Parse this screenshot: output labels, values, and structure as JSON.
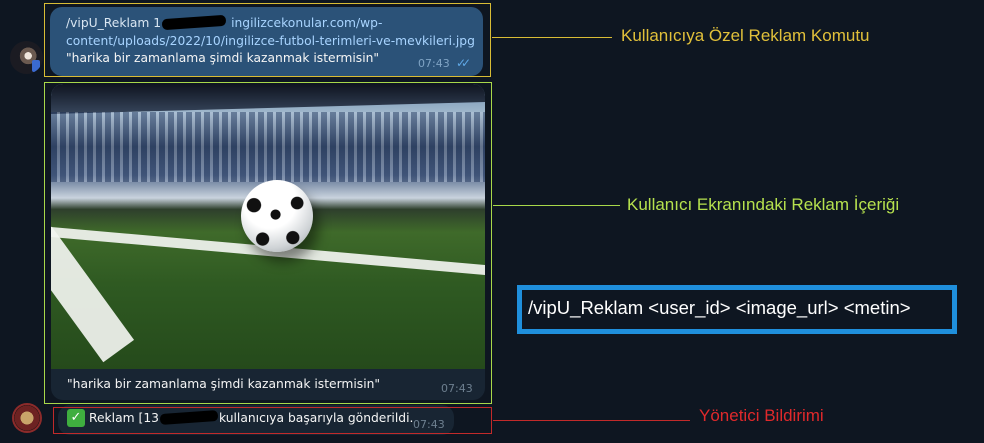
{
  "chat": {
    "command_message": {
      "text_prefix": "/vipU_Reklam 1",
      "link_part1": "ingilizcekonular.com/wp-",
      "link_part2": "content/uploads/2022/10/ingilizce-futbol-terimleri-ve-mevkileri.jpg",
      "message": "\"harika bir zamanlama şimdi kazanmak istermisin\"",
      "time": "07:43",
      "status_icon": "double-check-icon"
    },
    "photo_message": {
      "image_subject": "soccer ball on stadium corner line",
      "caption": "\"harika bir zamanlama şimdi kazanmak istermisin\"",
      "time": "07:43"
    },
    "admin_message": {
      "check_icon": "check-mark-icon",
      "text_prefix": "Reklam [13",
      "text_suffix": "kullanıcıya başarıyla gönderildi.",
      "time": "07:43"
    }
  },
  "annotations": {
    "command_label": "Kullanıcıya Özel Reklam Komutu",
    "content_label": "Kullanıcı Ekranındaki Reklam İçeriği",
    "admin_label": "Yönetici Bildirimi",
    "syntax": "/vipU_Reklam <user_id> <image_url> <metin>"
  },
  "colors": {
    "background": "#0e1621",
    "outgoing_bubble": "#2b5278",
    "incoming_bubble": "#182533",
    "command_annotation": "#e1c03a",
    "content_annotation": "#b6e14e",
    "admin_annotation": "#e0292b",
    "syntax_border": "#1f8fdc"
  }
}
